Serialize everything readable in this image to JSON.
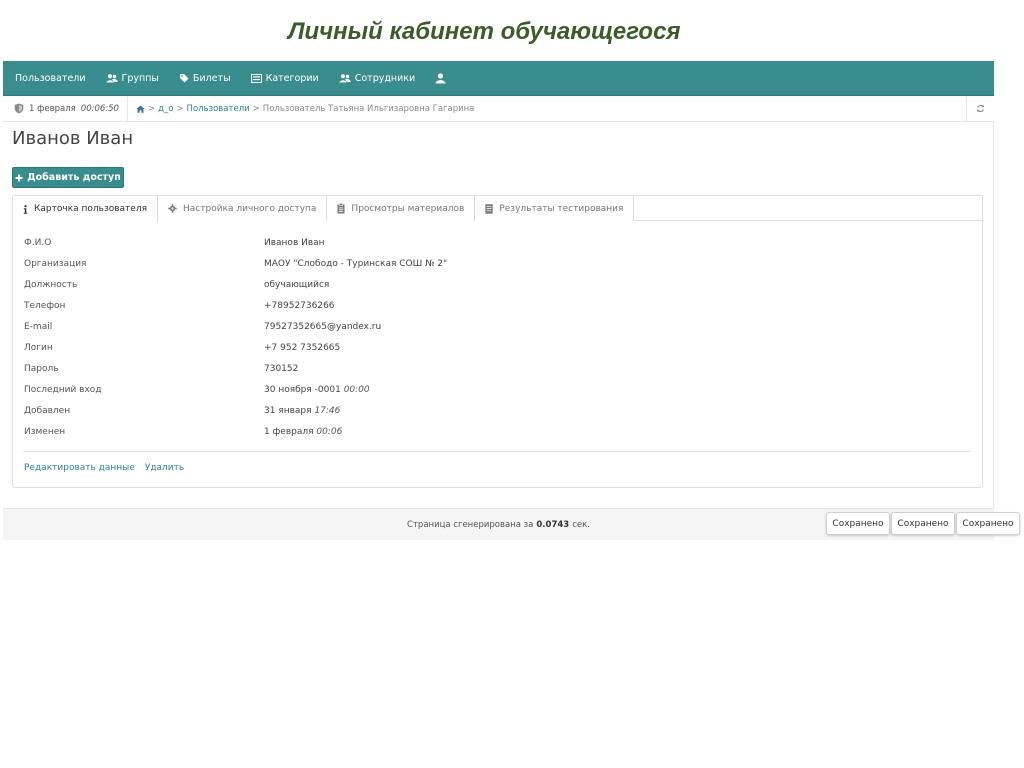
{
  "slide_title": "Личный кабинет обучающегося",
  "colors": {
    "brand": "#3a8d8d",
    "link": "#2f7f9b",
    "title": "#3d5a2a"
  },
  "navbar": {
    "items": [
      {
        "label": "Пользователи",
        "icon": ""
      },
      {
        "label": "Группы",
        "icon": "users-icon"
      },
      {
        "label": "Билеты",
        "icon": "tag-icon"
      },
      {
        "label": "Категории",
        "icon": "list-icon"
      },
      {
        "label": "Сотрудники",
        "icon": "users-icon"
      },
      {
        "label": "",
        "icon": "user-icon"
      }
    ]
  },
  "breadcrumb": {
    "date": "1 февраля",
    "time": "00:06:50",
    "home_icon": "home-icon",
    "items": [
      "д_о",
      "Пользователи",
      "Пользователь Татьяна Ильгизаровна Гагарина"
    ],
    "separator": ">"
  },
  "page_title": "Иванов Иван",
  "add_access_label": "Добавить доступ",
  "tabs": [
    {
      "label": "Карточка пользователя",
      "icon": "info-icon"
    },
    {
      "label": "Настройка личного доступа",
      "icon": "gear-icon"
    },
    {
      "label": "Просмотры материалов",
      "icon": "clipboard-icon"
    },
    {
      "label": "Результаты тестирования",
      "icon": "document-icon"
    }
  ],
  "profile": {
    "rows": [
      {
        "label": "Ф.И.О",
        "value": "Иванов Иван",
        "time": ""
      },
      {
        "label": "Организация",
        "value": "МАОУ \"Слободо - Туринская СОШ № 2\"",
        "time": ""
      },
      {
        "label": "Должность",
        "value": "обучающийся",
        "time": ""
      },
      {
        "label": "Телефон",
        "value": "+78952736266",
        "time": ""
      },
      {
        "label": "E-mail",
        "value": "79527352665@yandex.ru",
        "time": ""
      },
      {
        "label": "Логин",
        "value": "+7 952 7352665",
        "time": ""
      },
      {
        "label": "Пароль",
        "value": "730152",
        "time": ""
      },
      {
        "label": "Последний вход",
        "value": "30 ноября -0001",
        "time": "00:00"
      },
      {
        "label": "Добавлен",
        "value": "31 января",
        "time": "17:46"
      },
      {
        "label": "Изменен",
        "value": "1 февраля",
        "time": "00:06"
      }
    ]
  },
  "actions": {
    "edit": "Редактировать данные",
    "delete": "Удалить"
  },
  "footer": {
    "prefix": "Страница сгенерирована за",
    "value": "0.0743",
    "suffix": "сек."
  },
  "toasts": [
    "Сохранено",
    "Сохранено",
    "Сохранено"
  ]
}
